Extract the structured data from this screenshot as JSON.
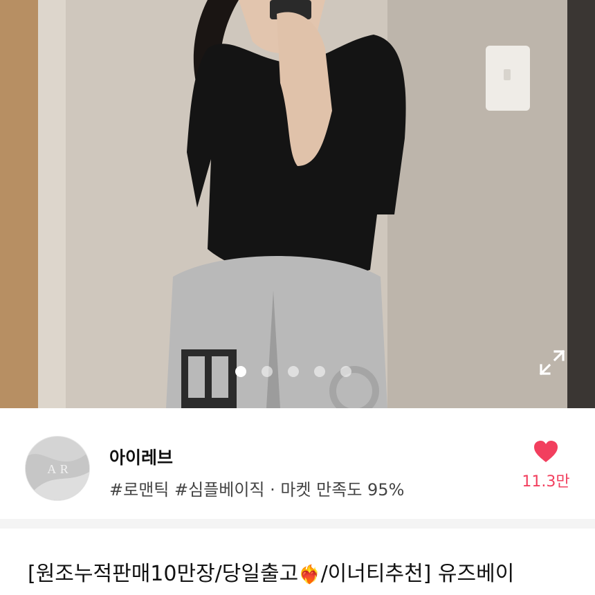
{
  "product": {
    "image_count": 5,
    "active_image_index": 0,
    "title_prefix": "[원조누적판매10만장/당일출고",
    "title_emoji": "❤‍🔥",
    "title_suffix": "/이너티추천] 유즈베이"
  },
  "store": {
    "name": "아이레브",
    "tags": "#로맨틱 #심플베이직 · 마켓 만족도 95%",
    "avatar_logo": "A R",
    "like_count": "11.3만"
  },
  "colors": {
    "like_heart": "#f23f5e",
    "divider": "#f4f4f4"
  },
  "icons": {
    "expand": "expand-icon",
    "like": "heart-icon"
  }
}
